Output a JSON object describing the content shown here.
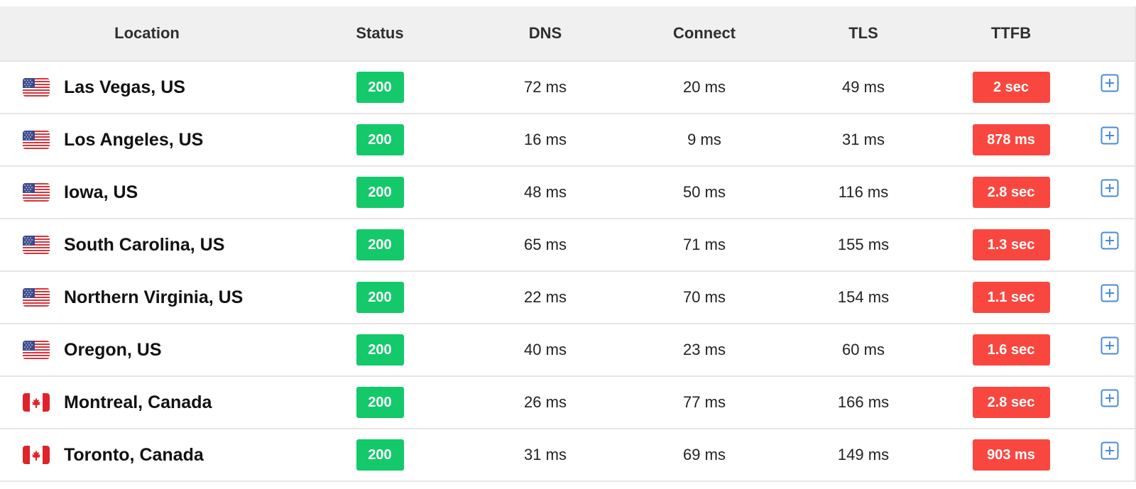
{
  "table": {
    "headers": {
      "location": "Location",
      "status": "Status",
      "dns": "DNS",
      "connect": "Connect",
      "tls": "TLS",
      "ttfb": "TTFB"
    },
    "rows": [
      {
        "flag": "us-flag-icon",
        "location": "Las Vegas, US",
        "status": "200",
        "dns": "72 ms",
        "connect": "20 ms",
        "tls": "49 ms",
        "ttfb": "2 sec"
      },
      {
        "flag": "us-flag-icon",
        "location": "Los Angeles, US",
        "status": "200",
        "dns": "16 ms",
        "connect": "9 ms",
        "tls": "31 ms",
        "ttfb": "878 ms"
      },
      {
        "flag": "us-flag-icon",
        "location": "Iowa, US",
        "status": "200",
        "dns": "48 ms",
        "connect": "50 ms",
        "tls": "116 ms",
        "ttfb": "2.8 sec"
      },
      {
        "flag": "us-flag-icon",
        "location": "South Carolina, US",
        "status": "200",
        "dns": "65 ms",
        "connect": "71 ms",
        "tls": "155 ms",
        "ttfb": "1.3 sec"
      },
      {
        "flag": "us-flag-icon",
        "location": "Northern Virginia, US",
        "status": "200",
        "dns": "22 ms",
        "connect": "70 ms",
        "tls": "154 ms",
        "ttfb": "1.1 sec"
      },
      {
        "flag": "us-flag-icon",
        "location": "Oregon, US",
        "status": "200",
        "dns": "40 ms",
        "connect": "23 ms",
        "tls": "60 ms",
        "ttfb": "1.6 sec"
      },
      {
        "flag": "canada-flag-icon",
        "location": "Montreal, Canada",
        "status": "200",
        "dns": "26 ms",
        "connect": "77 ms",
        "tls": "166 ms",
        "ttfb": "2.8 sec"
      },
      {
        "flag": "canada-flag-icon",
        "location": "Toronto, Canada",
        "status": "200",
        "dns": "31 ms",
        "connect": "69 ms",
        "tls": "149 ms",
        "ttfb": "903 ms"
      }
    ]
  },
  "colors": {
    "status_ok": "#13c96a",
    "ttfb_slow": "#f9473f",
    "expand_icon": "#4a8ad8",
    "header_bg": "#f0f0f0"
  },
  "icons": {
    "expand": "plus-square-icon"
  }
}
